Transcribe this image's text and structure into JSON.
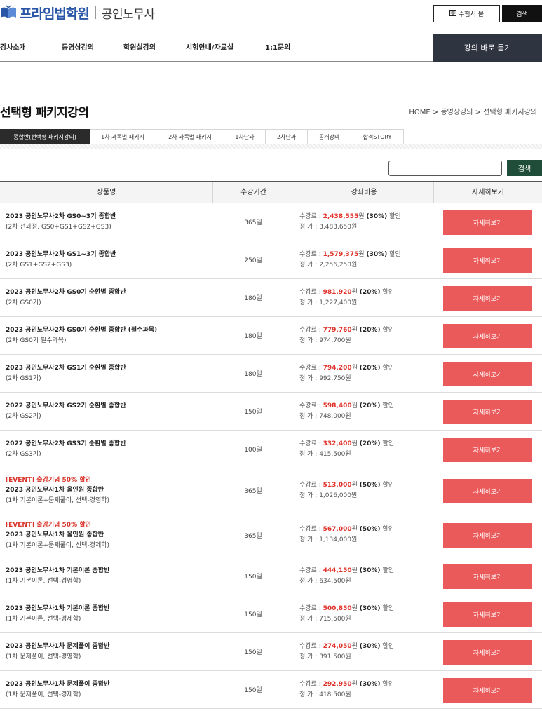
{
  "header": {
    "logo_name": "프라임법학원",
    "logo_sub": "공인노무사",
    "ticket_button": "수험서 몰",
    "search_button": "검색"
  },
  "nav": {
    "items": [
      "강사소개",
      "동영상강의",
      "학원실강의",
      "시험안내/자료실",
      "1:1문의"
    ],
    "cta": "강의 바로 듣기"
  },
  "page": {
    "title": "선택형 패키지강의",
    "breadcrumb": "HOME  >  동영상강의  >  선택형 패키지강의"
  },
  "tabs": [
    "종합반(선택형 패키지강의)",
    "1차 과목별 패키지",
    "2차 과목별 패키지",
    "1차단과",
    "2차단과",
    "공개강의",
    "합격STORY"
  ],
  "active_tab": 0,
  "search": {
    "placeholder": "",
    "button": "검색"
  },
  "table": {
    "headers": [
      "상품명",
      "수강기간",
      "강좌비용",
      "자세히보기"
    ],
    "fee_label": "수강료 : ",
    "list_label": "정   가 : ",
    "won": "원",
    "discount_word": "할인",
    "detail_label": "자세히보기",
    "rows": [
      {
        "event": "",
        "name": "2023 공인노무사2차 GS0~3기 종합반",
        "sub": "(2차 전과정, GS0+GS1+GS2+GS3)",
        "period": "365일",
        "sale": "2,438,555",
        "pct": "(30%)",
        "list": "3,483,650원"
      },
      {
        "event": "",
        "name": "2023 공인노무사2차 GS1~3기 종합반",
        "sub": "(2차 GS1+GS2+GS3)",
        "period": "250일",
        "sale": "1,579,375",
        "pct": "(30%)",
        "list": "2,256,250원"
      },
      {
        "event": "",
        "name": "2023 공인노무사2차 GS0기 순환별 종합반",
        "sub": "(2차 GS0기)",
        "period": "180일",
        "sale": "981,920",
        "pct": "(20%)",
        "list": "1,227,400원"
      },
      {
        "event": "",
        "name": "2023 공인노무사2차 GS0기 순환별 종합반 (필수과목)",
        "sub": "(2차 GS0기 필수과목)",
        "period": "180일",
        "sale": "779,760",
        "pct": "(20%)",
        "list": "974,700원"
      },
      {
        "event": "",
        "name": "2023 공인노무사2차 GS1기 순환별 종합반",
        "sub": "(2차 GS1기)",
        "period": "180일",
        "sale": "794,200",
        "pct": "(20%)",
        "list": "992,750원"
      },
      {
        "event": "",
        "name": "2022 공인노무사2차 GS2기 순환별 종합반",
        "sub": "(2차 GS2기)",
        "period": "150일",
        "sale": "598,400",
        "pct": "(20%)",
        "list": "748,000원"
      },
      {
        "event": "",
        "name": "2022 공인노무사2차 GS3기 순환별 종합반",
        "sub": "(2차 GS3기)",
        "period": "100일",
        "sale": "332,400",
        "pct": "(20%)",
        "list": "415,500원"
      },
      {
        "event": "[EVENT] 출강기념 50% 할인",
        "name": "2023 공인노무사1차 올인원 종합반",
        "sub": "(1차 기본이론+문제풀이, 선택-경영학)",
        "period": "365일",
        "sale": "513,000",
        "pct": "(50%)",
        "list": "1,026,000원"
      },
      {
        "event": "[EVENT] 출강기념 50% 할인",
        "name": "2023 공인노무사1차 올인원 종합반",
        "sub": "(1차 기본이론+문제풀이, 선택-경제학)",
        "period": "365일",
        "sale": "567,000",
        "pct": "(50%)",
        "list": "1,134,000원"
      },
      {
        "event": "",
        "name": "2023 공인노무사1차 기본이론 종합반",
        "sub": "(1차 기본이론, 선택-경영학)",
        "period": "150일",
        "sale": "444,150",
        "pct": "(30%)",
        "list": "634,500원"
      },
      {
        "event": "",
        "name": "2023 공인노무사1차 기본이론 종합반",
        "sub": "(1차 기본이론, 선택-경제학)",
        "period": "150일",
        "sale": "500,850",
        "pct": "(30%)",
        "list": "715,500원"
      },
      {
        "event": "",
        "name": "2023 공인노무사1차 문제풀이 종합반",
        "sub": "(1차 문제풀이, 선택-경영학)",
        "period": "150일",
        "sale": "274,050",
        "pct": "(30%)",
        "list": "391,500원"
      },
      {
        "event": "",
        "name": "2023 공인노무사1차 문제풀이 종합반",
        "sub": "(1차 문제풀이, 선택-경제학)",
        "period": "150일",
        "sale": "292,950",
        "pct": "(30%)",
        "list": "418,500원"
      }
    ]
  },
  "colors": {
    "brand_blue": "#2a56a8",
    "sale_red": "#e0322a",
    "detail_button": "#eb5a5a",
    "nav_cta": "#2f3441",
    "search_green": "#1f4d3a"
  }
}
